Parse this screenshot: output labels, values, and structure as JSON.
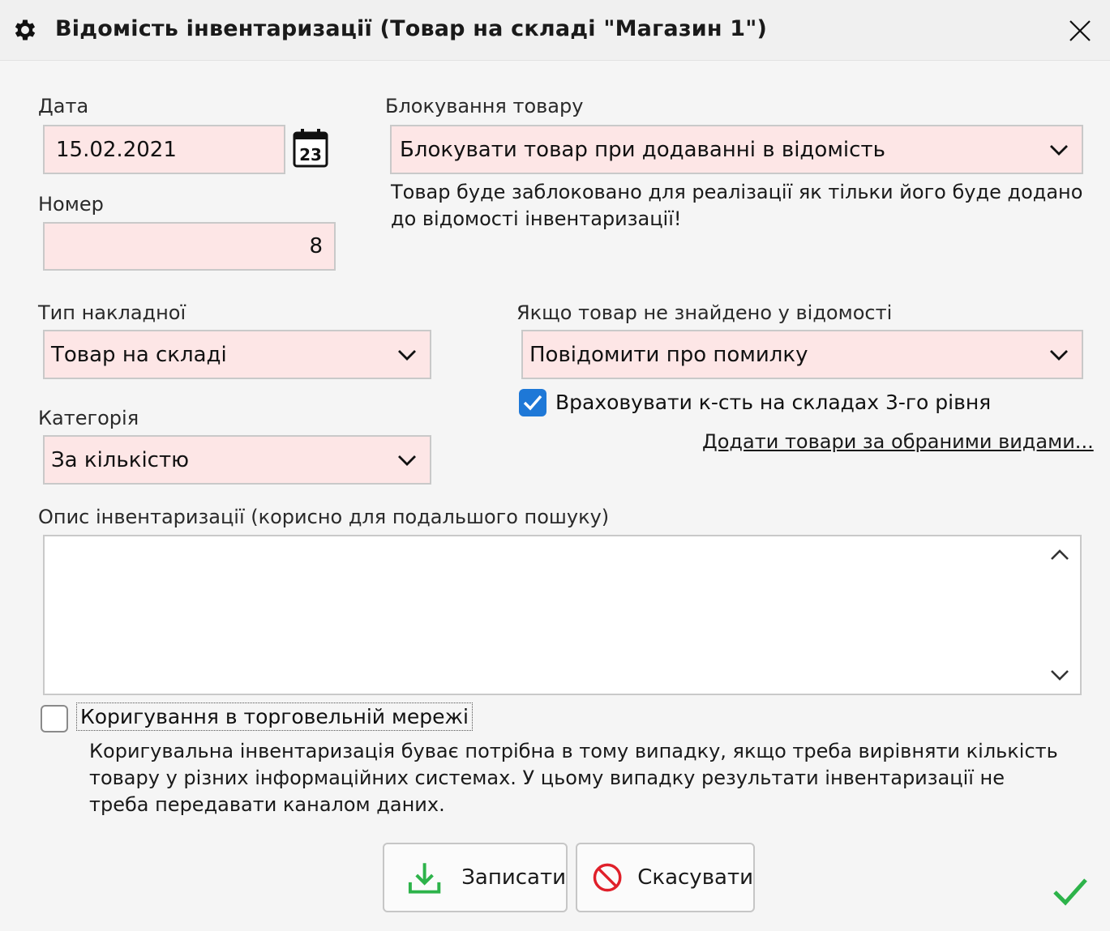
{
  "window": {
    "title": "Відомість інвентаризації (Товар на складі \"Магазин 1\")"
  },
  "date": {
    "label": "Дата",
    "value": "15.02.2021",
    "calendar_day": "23"
  },
  "number": {
    "label": "Номер",
    "value": "8"
  },
  "blocking": {
    "label": "Блокування товару",
    "value": "Блокувати товар при додаванні в відомість",
    "hint": "Товар буде заблоковано для реалізації як тільки його буде додано до відомості інвентаризації!"
  },
  "invoice_type": {
    "label": "Тип накладної",
    "value": "Товар на складі"
  },
  "not_found": {
    "label": "Якщо товар не знайдено у відомості",
    "value": "Повідомити про помилку"
  },
  "level3": {
    "label": "Враховувати к-сть на складах 3-го рівня",
    "checked": true
  },
  "add_link": "Додати товари за обраними видами...",
  "category": {
    "label": "Категорія",
    "value": "За кількістю"
  },
  "description": {
    "label": "Опис інвентаризації (корисно для подальшого пошуку)",
    "value": ""
  },
  "correction": {
    "label": "Коригування в торговельній мережі",
    "checked": false,
    "hint": "Коригувальна інвентаризація буває потрібна в тому випадку, якщо треба вирівняти кількість товару у різних інформаційних системах. У цьому випадку результати інвентаризації не треба передавати каналом даних."
  },
  "buttons": {
    "save": "Записати",
    "cancel": "Скасувати"
  },
  "colors": {
    "field_bg": "#fde6e6",
    "checkbox_on": "#1e78d7",
    "save_icon": "#2db34a",
    "cancel_icon": "#e0202a",
    "ok_check": "#2db34a"
  }
}
